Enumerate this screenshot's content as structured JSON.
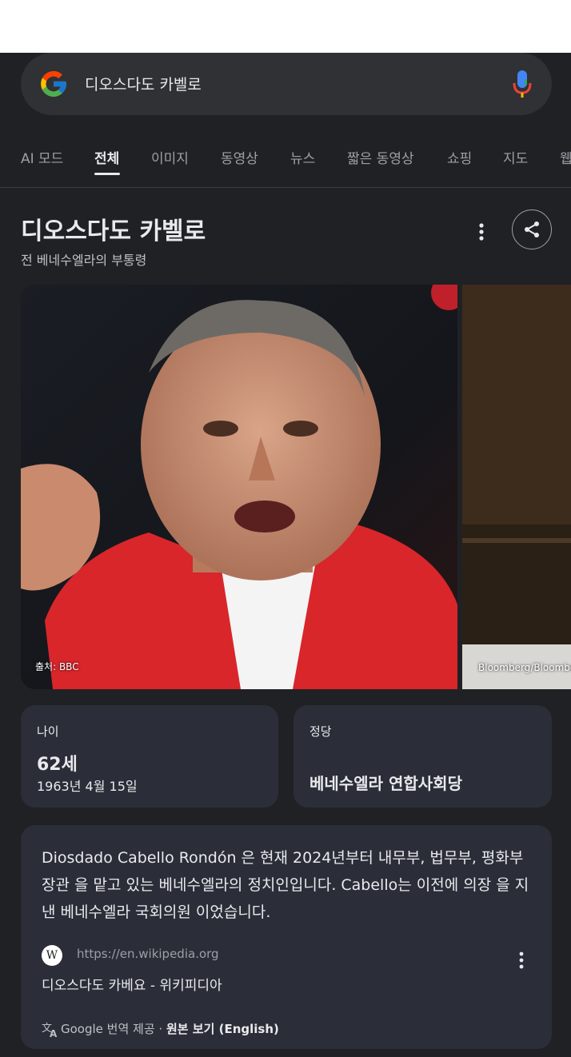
{
  "search": {
    "query": "디오스다도 카벨로"
  },
  "tabs": [
    {
      "label": "AI 모드"
    },
    {
      "label": "전체"
    },
    {
      "label": "이미지"
    },
    {
      "label": "동영상"
    },
    {
      "label": "뉴스"
    },
    {
      "label": "짧은 동영상"
    },
    {
      "label": "쇼핑"
    },
    {
      "label": "지도"
    },
    {
      "label": "웹"
    }
  ],
  "knowledge_panel": {
    "title": "디오스다도 카벨로",
    "subtitle": "전 베네수엘라의 부통령",
    "images": [
      {
        "caption": "출처: BBC"
      },
      {
        "caption": "Bloomberg/Bloomberg"
      }
    ],
    "facts": {
      "age_label": "나이",
      "age_value": "62세",
      "birth_date": "1963년 4월 15일",
      "party_label": "정당",
      "party_value": "베네수엘라 연합사회당"
    },
    "description": {
      "text": "Diosdado Cabello Rondón 은 현재 2024년부터 내무부, 법무부, 평화부 장관 을 맡고 있는 베네수엘라의 정치인입니다. Cabello는 이전에 의장 을 지낸 베네수엘라 국회의원 이었습니다.",
      "source_icon": "W",
      "source_url": "https://en.wikipedia.org",
      "source_title": "디오스다도 카베요 - 위키피디아",
      "translate_provider": "Google 번역 제공",
      "translate_separator": " · ",
      "view_original": "원본 보기 (English)"
    }
  },
  "colors": {
    "background": "#202124",
    "card": "#2b2e38",
    "jacket_red": "#d8262b"
  }
}
